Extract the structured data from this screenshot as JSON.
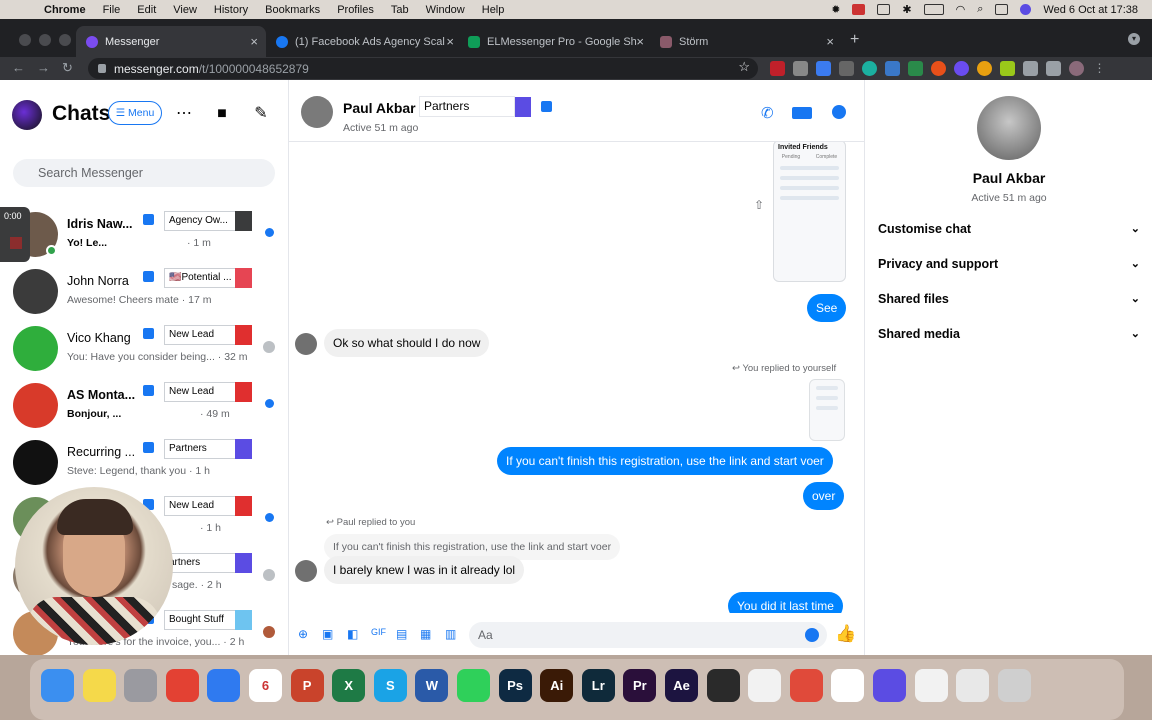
{
  "menubar": {
    "app": "Chrome",
    "items": [
      "File",
      "Edit",
      "View",
      "History",
      "Bookmarks",
      "Profiles",
      "Tab",
      "Window",
      "Help"
    ],
    "datetime": "Wed 6 Oct at 17:38"
  },
  "browser": {
    "tabs": [
      {
        "label": "Messenger",
        "favicon_color": "#7b4cf0",
        "active": true
      },
      {
        "label": "(1) Facebook Ads Agency Scal",
        "favicon_color": "#1877f2",
        "active": false
      },
      {
        "label": "ELMessenger Pro - Google She",
        "favicon_color": "#0f9d58",
        "active": false
      },
      {
        "label": "Störm",
        "favicon_color": "#8a5a6a",
        "active": false
      }
    ],
    "url_host": "messenger.com",
    "url_path": "/t/100000048652879"
  },
  "sidebar": {
    "title": "Chats",
    "menu_label": "☰ Menu",
    "search_placeholder": "Search Messenger",
    "recording_time": "0:00",
    "conversations": [
      {
        "name": "Idris Naw...",
        "preview": "Yo! Le...",
        "time": "· 1 m",
        "tag": "Agency Ow...",
        "tag_color": "#3a3b3c",
        "unread": true,
        "avatar_color": "#6d5a4b"
      },
      {
        "name": "John Norra",
        "preview": "Awesome! Cheers mate · 17 m",
        "time": "",
        "tag": "🇺🇸Potential ...",
        "tag_color": "#e64553",
        "unread": false,
        "avatar_color": "#3b3b3b"
      },
      {
        "name": "Vico Khang",
        "preview": "You: Have you consider being... · 32 m",
        "time": "",
        "tag": "New Lead",
        "tag_color": "#e02f2f",
        "unread": false,
        "avatar_color": "#2fae3c"
      },
      {
        "name": "AS Monta...",
        "preview": "Bonjour, ...",
        "time": "· 49 m",
        "tag": "New Lead",
        "tag_color": "#e02f2f",
        "unread": true,
        "avatar_color": "#d83a2a"
      },
      {
        "name": "Recurring ...",
        "preview": "Steve: Legend, thank you · 1 h",
        "time": "",
        "tag": "Partners",
        "tag_color": "#5b4ce3",
        "unread": false,
        "avatar_color": "#111111"
      },
      {
        "name": "",
        "preview": "",
        "time": "· 1 h",
        "tag": "New Lead",
        "tag_color": "#e02f2f",
        "unread": true,
        "avatar_color": "#6b8f5a"
      },
      {
        "name": "",
        "preview": "sage. · 2 h",
        "time": "",
        "tag": "artners",
        "tag_color": "#5b4ce3",
        "unread": false,
        "avatar_color": "#8a7a6a"
      },
      {
        "name": "",
        "preview": "You: Here's for the invoice, you... · 2 h",
        "time": "",
        "tag": "Bought Stuff",
        "tag_color": "#6ec4f0",
        "unread": false,
        "avatar_color": "#c48a5a"
      }
    ]
  },
  "chat": {
    "contact_name": "Paul Akbar",
    "tag": "Partners",
    "tag_color": "#5b4ce3",
    "status": "Active 51 m ago",
    "thumbnail_title": "Invited Friends",
    "thumbnail_tabs": [
      "Pending",
      "Complete"
    ],
    "messages": {
      "see": "See",
      "ok_so": "Ok so what should I do now",
      "replied_self": "You replied to yourself",
      "if_you_cant": "If you can't finish this registration, use the link and start voer",
      "over": "over",
      "paul_replied": "Paul replied to you",
      "quoted": "If you can't finish this registration, use the link and start voer",
      "barely": "I barely knew I was in it already lol",
      "did_it": "You did it last time"
    },
    "composer_placeholder": "Aa"
  },
  "right_panel": {
    "name": "Paul Akbar",
    "status": "Active 51 m ago",
    "sections": [
      "Customise chat",
      "Privacy and support",
      "Shared files",
      "Shared media"
    ]
  },
  "dock": {
    "apps": [
      {
        "name": "finder",
        "label": "",
        "color": "#3b8ff0"
      },
      {
        "name": "notes",
        "label": "",
        "color": "#f5d94a"
      },
      {
        "name": "launchpad",
        "label": "",
        "color": "#9a9aa0"
      },
      {
        "name": "chrome",
        "label": "",
        "color": "#e34133"
      },
      {
        "name": "maps",
        "label": "",
        "color": "#2f7af0"
      },
      {
        "name": "calendar",
        "label": "6",
        "color": "#ffffff"
      },
      {
        "name": "powerpoint",
        "label": "P",
        "color": "#c9432b"
      },
      {
        "name": "excel",
        "label": "X",
        "color": "#1e7a45"
      },
      {
        "name": "skype",
        "label": "S",
        "color": "#1aa3e6"
      },
      {
        "name": "word",
        "label": "W",
        "color": "#2a5aa8"
      },
      {
        "name": "whatsapp",
        "label": "",
        "color": "#2fd05a"
      },
      {
        "name": "photoshop",
        "label": "Ps",
        "color": "#0e2a42"
      },
      {
        "name": "illustrator",
        "label": "Ai",
        "color": "#3a1a06"
      },
      {
        "name": "lightroom",
        "label": "Lr",
        "color": "#0f2a3a"
      },
      {
        "name": "premiere",
        "label": "Pr",
        "color": "#2a0f3a"
      },
      {
        "name": "after-effects",
        "label": "Ae",
        "color": "#1c1440"
      },
      {
        "name": "figma",
        "label": "",
        "color": "#2a2a2a"
      },
      {
        "name": "numbers",
        "label": "",
        "color": "#f2f2f2"
      },
      {
        "name": "popcorn",
        "label": "",
        "color": "#e04a3a"
      },
      {
        "name": "slack",
        "label": "",
        "color": "#ffffff"
      },
      {
        "name": "gear-app",
        "label": "",
        "color": "#5b4ce3"
      },
      {
        "name": "textedit",
        "label": "",
        "color": "#f2f2f2"
      },
      {
        "name": "preview-files",
        "label": "",
        "color": "#e8e8e8"
      },
      {
        "name": "trash",
        "label": "",
        "color": "#cfcfcf"
      }
    ]
  }
}
